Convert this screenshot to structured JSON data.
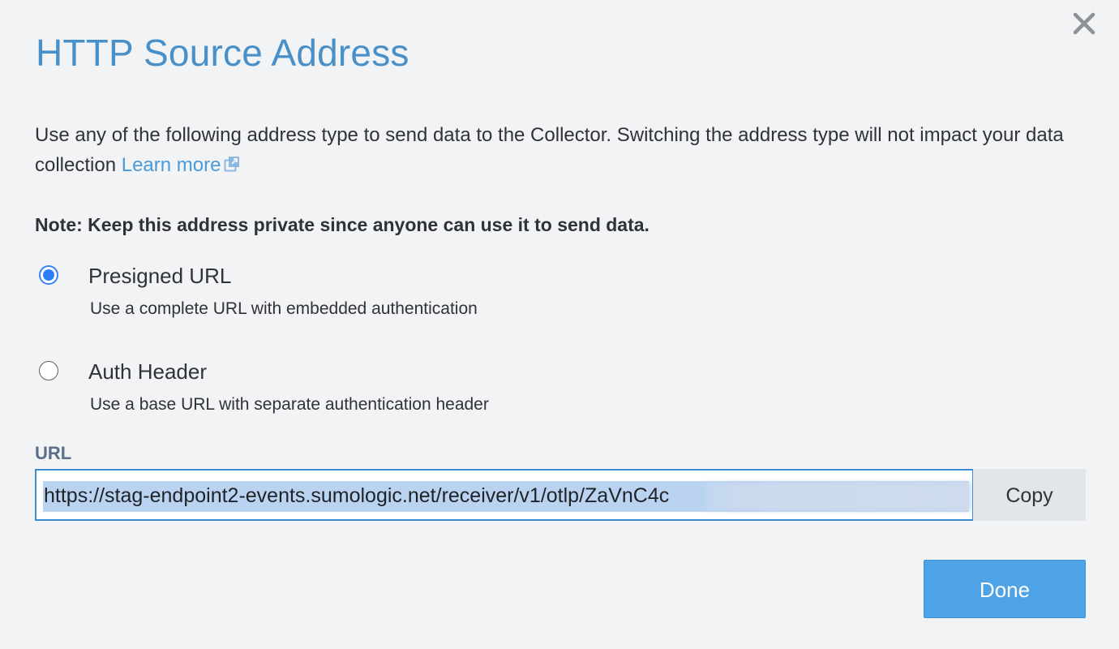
{
  "dialog": {
    "title": "HTTP Source Address",
    "description": "Use any of the following address type to send data to the Collector. Switching the address type will not impact your data collection",
    "learn_more": "Learn more",
    "note": "Note: Keep this address private since anyone can use it to send data.",
    "close_icon": "close-icon",
    "external_link_icon": "external-link-icon"
  },
  "options": [
    {
      "label": "Presigned URL",
      "description": "Use a complete URL with embedded authentication",
      "selected": true
    },
    {
      "label": "Auth Header",
      "description": "Use a base URL with separate authentication header",
      "selected": false
    }
  ],
  "url_field": {
    "label": "URL",
    "value": "https://stag-endpoint2-events.sumologic.net/receiver/v1/otlp/ZaVnC4c",
    "copy_label": "Copy"
  },
  "footer": {
    "done_label": "Done"
  },
  "colors": {
    "title": "#4a90c8",
    "link": "#4a9ad8",
    "radio_selected": "#2f7df6",
    "done_button": "#4da3e6",
    "selection_highlight": "#b9d3f1"
  }
}
